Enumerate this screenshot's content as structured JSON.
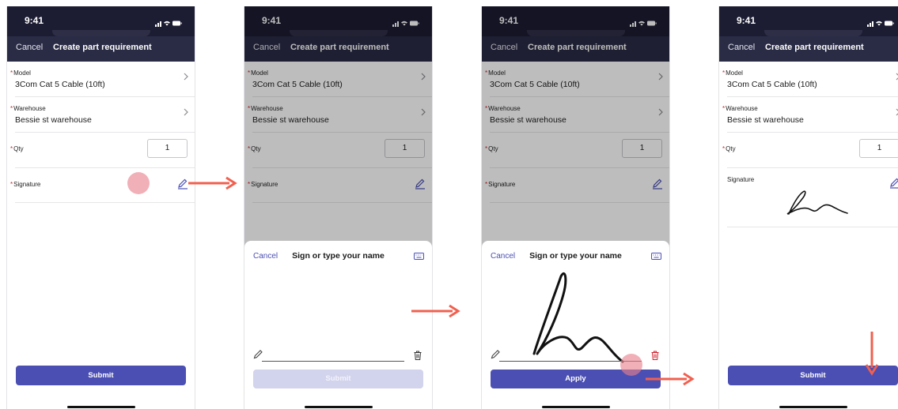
{
  "colors": {
    "accent": "#4b4fb3",
    "required": "#d1202c",
    "arrow": "#f0604f",
    "navbar": "#2a2b45"
  },
  "status": {
    "time": "9:41"
  },
  "nav": {
    "cancel": "Cancel",
    "title": "Create part requirement"
  },
  "form": {
    "model_label": "Model",
    "model_value": "3Com Cat 5 Cable (10ft)",
    "warehouse_label": "Warehouse",
    "warehouse_value": "Bessie st warehouse",
    "qty_label": "Qty",
    "qty_value": "1",
    "signature_label": "Signature"
  },
  "sheet": {
    "cancel": "Cancel",
    "title": "Sign or type your name"
  },
  "buttons": {
    "submit": "Submit",
    "apply": "Apply"
  },
  "icons": {
    "chevron": "chevron-right-icon",
    "pencil": "pencil-icon",
    "keyboard": "keyboard-icon",
    "trash": "trash-icon",
    "signal": "signal-icon",
    "wifi": "wifi-icon",
    "battery": "battery-icon"
  }
}
